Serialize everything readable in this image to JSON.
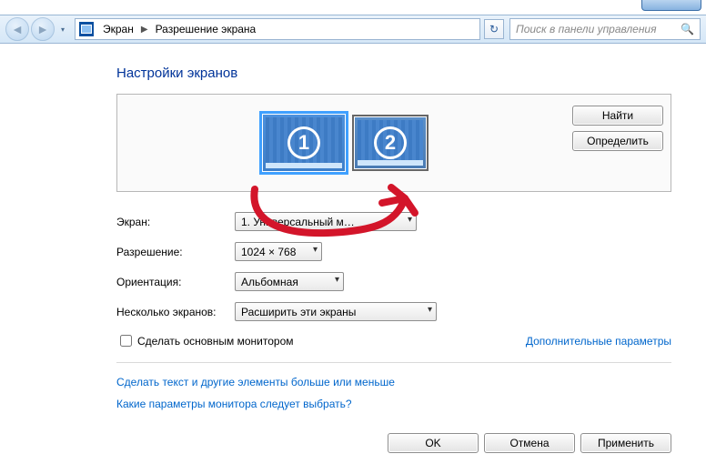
{
  "nav": {
    "crumb1": "Экран",
    "crumb2": "Разрешение экрана",
    "search_placeholder": "Поиск в панели управления"
  },
  "page_title": "Настройки экранов",
  "monitors": {
    "m1_label": "1",
    "m2_label": "2"
  },
  "side_buttons": {
    "find": "Найти",
    "identify": "Определить"
  },
  "form": {
    "screen_label": "Экран:",
    "screen_value": "1. Универсальный м…",
    "resolution_label": "Разрешение:",
    "resolution_value": "1024 × 768",
    "orientation_label": "Ориентация:",
    "orientation_value": "Альбомная",
    "multi_label": "Несколько экранов:",
    "multi_value": "Расширить эти экраны"
  },
  "checkbox": {
    "label": "Сделать основным монитором"
  },
  "links": {
    "advanced": "Дополнительные параметры",
    "text_size": "Сделать текст и другие элементы больше или меньше",
    "which_monitor": "Какие параметры монитора следует выбрать?"
  },
  "bottom": {
    "ok": "OK",
    "cancel": "Отмена",
    "apply": "Применить"
  }
}
